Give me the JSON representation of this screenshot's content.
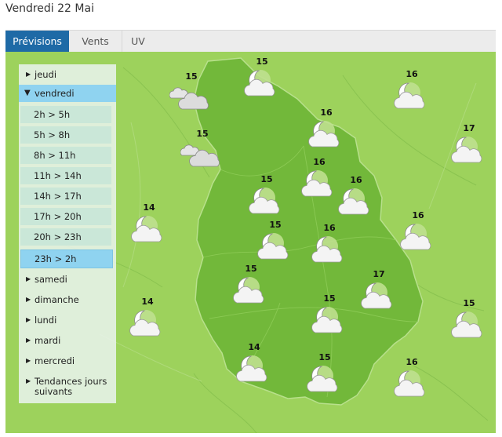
{
  "header": {
    "date_title": "Vendredi 22 Mai"
  },
  "tabs": [
    {
      "label": "Prévisions",
      "active": true
    },
    {
      "label": "Vents",
      "active": false
    },
    {
      "label": "UV",
      "active": false
    }
  ],
  "sidebar": {
    "days_before": [
      {
        "label": "jeudi"
      }
    ],
    "open_day": {
      "label": "vendredi"
    },
    "slots": [
      {
        "label": "2h > 5h"
      },
      {
        "label": "5h > 8h"
      },
      {
        "label": "8h > 11h"
      },
      {
        "label": "11h > 14h"
      },
      {
        "label": "14h > 17h"
      },
      {
        "label": "17h > 20h"
      },
      {
        "label": "20h > 23h"
      },
      {
        "label": "23h > 2h",
        "selected": true
      }
    ],
    "days_after": [
      {
        "label": "samedi"
      },
      {
        "label": "dimanche"
      },
      {
        "label": "lundi"
      },
      {
        "label": "mardi"
      },
      {
        "label": "mercredi"
      },
      {
        "label": "Tendances jours suivants"
      }
    ]
  },
  "colors": {
    "tab_active": "#1e6aa6",
    "map_outer": "#9dd25c",
    "region_fill": "#72b83a",
    "sidebar_selected": "#8fd3f0"
  },
  "map_icons": [
    {
      "temp": "15",
      "icon": "moon-cloud-icon"
    },
    {
      "temp": "15",
      "icon": "cloud-icon"
    },
    {
      "temp": "16",
      "icon": "moon-cloud-icon"
    },
    {
      "temp": "16",
      "icon": "moon-cloud-icon"
    },
    {
      "temp": "15",
      "icon": "cloud-icon"
    },
    {
      "temp": "17",
      "icon": "moon-cloud-icon"
    },
    {
      "temp": "15",
      "icon": "moon-cloud-icon"
    },
    {
      "temp": "16",
      "icon": "moon-cloud-icon"
    },
    {
      "temp": "16",
      "icon": "moon-cloud-icon"
    },
    {
      "temp": "14",
      "icon": "moon-cloud-icon"
    },
    {
      "temp": "16",
      "icon": "moon-cloud-icon"
    },
    {
      "temp": "15",
      "icon": "moon-cloud-icon"
    },
    {
      "temp": "16",
      "icon": "moon-cloud-icon"
    },
    {
      "temp": "15",
      "icon": "moon-cloud-icon"
    },
    {
      "temp": "17",
      "icon": "moon-cloud-icon"
    },
    {
      "temp": "14",
      "icon": "moon-cloud-icon"
    },
    {
      "temp": "15",
      "icon": "moon-cloud-icon"
    },
    {
      "temp": "15",
      "icon": "moon-cloud-icon"
    },
    {
      "temp": "14",
      "icon": "moon-cloud-icon"
    },
    {
      "temp": "15",
      "icon": "moon-cloud-icon"
    },
    {
      "temp": "16",
      "icon": "moon-cloud-icon"
    }
  ]
}
